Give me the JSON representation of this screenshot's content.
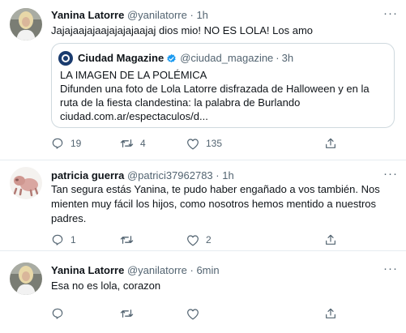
{
  "tweets": [
    {
      "name": "Yanina Latorre",
      "handle": "@yanilatorre",
      "time": "1h",
      "text": "Jajajaajajaajajajajaajaj dios mio! NO ES LOLA! Los amo",
      "quote": {
        "name": "Ciudad Magazine",
        "handle": "@ciudad_magazine",
        "time": "3h",
        "line1": "LA IMAGEN DE LA POLÉMICA",
        "line2": "Difunden una foto de Lola Latorre disfrazada de Halloween y en la ruta de la fiesta clandestina: la palabra de Burlando",
        "line3": "ciudad.com.ar/espectaculos/d..."
      },
      "replies": "19",
      "retweets": "4",
      "likes": "135"
    },
    {
      "name": "patricia guerra",
      "handle": "@patrici37962783",
      "time": "1h",
      "text": "Tan segura estás Yanina, te pudo haber engañado a vos también. Nos mienten muy fácil los hijos, como nosotros hemos mentido a nuestros padres.",
      "replies": "1",
      "retweets": "",
      "likes": "2"
    },
    {
      "name": "Yanina Latorre",
      "handle": "@yanilatorre",
      "time": "6min",
      "text": "Esa no es lola, corazon",
      "replies": "",
      "retweets": "",
      "likes": ""
    }
  ],
  "ui": {
    "dot": "·",
    "more": "···"
  },
  "icons": {
    "reply": "reply-icon",
    "retweet": "retweet-icon",
    "like": "heart-icon",
    "share": "share-icon",
    "verified": "verified-badge-icon"
  },
  "colors": {
    "text": "#0f1419",
    "secondary": "#536471",
    "border": "#cfd9de",
    "verified": "#1d9bf0"
  }
}
